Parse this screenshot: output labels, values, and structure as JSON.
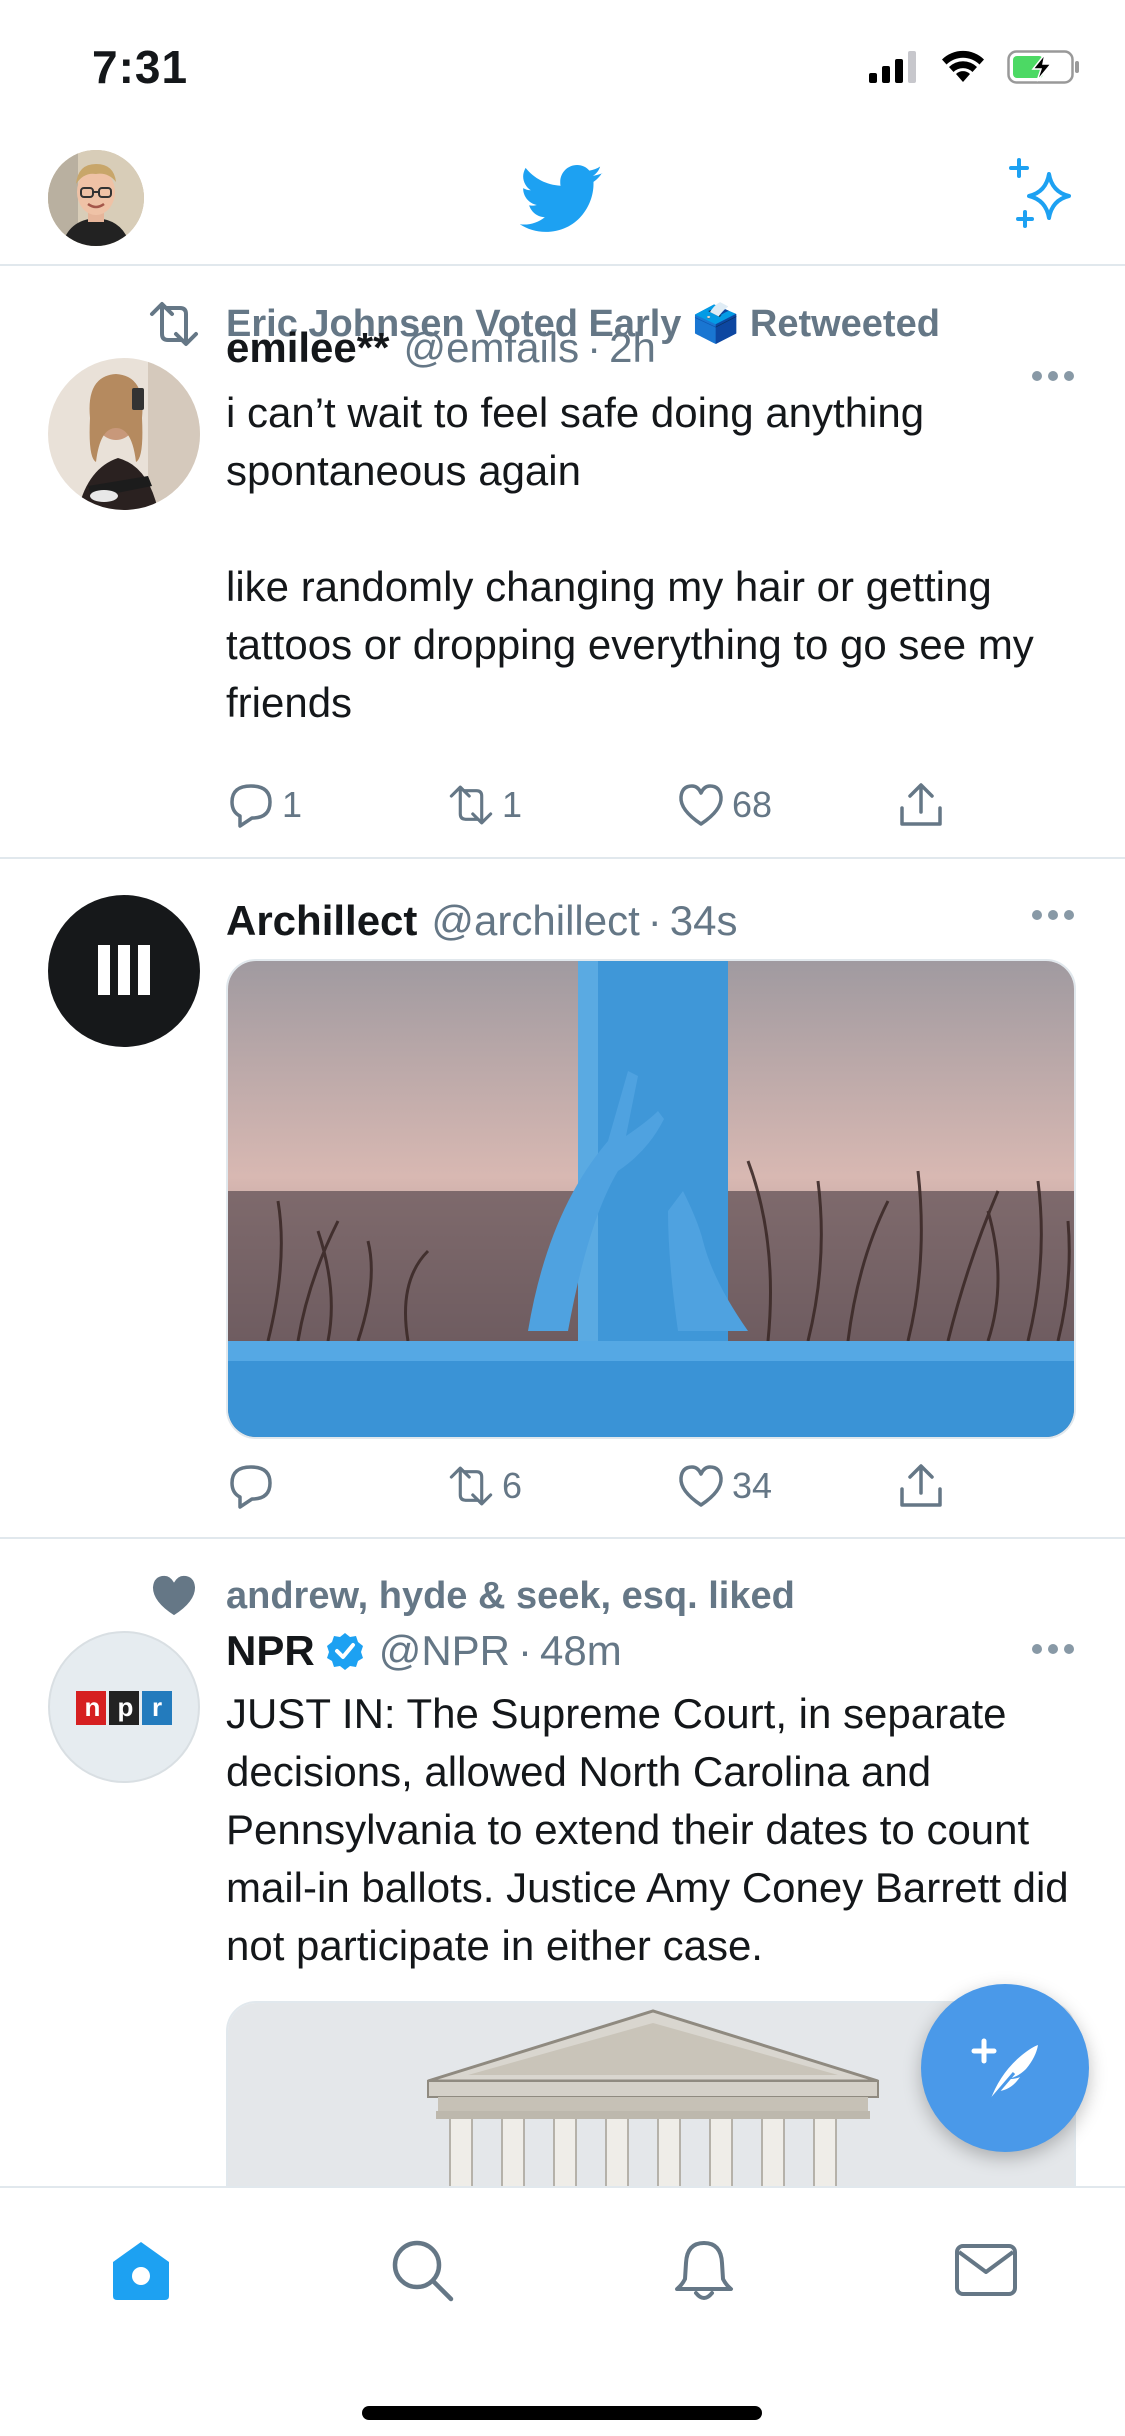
{
  "status_bar": {
    "time": "7:31",
    "icons": [
      "signal-icon",
      "wifi-icon",
      "battery-charging-icon"
    ]
  },
  "header": {
    "avatar_icon": "profile-avatar",
    "logo_icon": "twitter-bird-icon",
    "sparkle_icon": "sparkle-icon"
  },
  "colors": {
    "accent": "#1da1f2",
    "secondary_text": "#657786",
    "divider": "#e1e8ed",
    "fab": "#4a99e9"
  },
  "tweets": [
    {
      "context_icon": "retweet-icon",
      "context_text": "Eric Johnsen Voted Early 🗳️ Retweeted",
      "name": "emilee**",
      "handle": "@emfails",
      "separator": "·",
      "time": "2h",
      "text_1": "i can’t wait to feel safe doing anything spontaneous again",
      "text_2": "like randomly changing my hair or getting tattoos or dropping everything to go see my friends",
      "reply_count": "1",
      "retweet_count": "1",
      "like_count": "68"
    },
    {
      "name": "Archillect",
      "handle": "@archillect",
      "separator": "·",
      "time": "34s",
      "avatar_icon": "archillect-logo",
      "media_icon": "blue-pillar-hands-image",
      "reply_count": "",
      "retweet_count": "6",
      "like_count": "34"
    },
    {
      "context_icon": "heart-icon",
      "context_text": "andrew, hyde & seek, esq. liked",
      "name": "NPR",
      "verified_icon": "verified-badge-icon",
      "handle": "@NPR",
      "separator": "·",
      "time": "48m",
      "avatar_text": "npr",
      "text_1": "JUST IN: The Supreme Court, in separate decisions, allowed North Carolina and Pennsylvania to extend their dates to count mail-in ballots. Justice Amy Coney Barrett did not participate in either case.",
      "media_icon": "supreme-court-building-image"
    }
  ],
  "fab": {
    "icon": "compose-tweet-icon"
  },
  "tab_bar": {
    "items": [
      "home-icon",
      "search-icon",
      "notifications-icon",
      "messages-icon"
    ],
    "active": "home-icon"
  }
}
